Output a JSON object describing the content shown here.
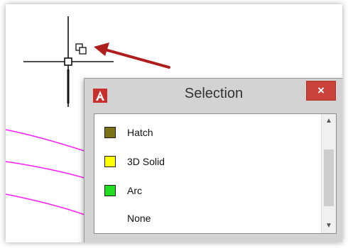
{
  "dialog": {
    "title": "Selection",
    "close_label": "×",
    "items": [
      {
        "label": "Hatch",
        "color": "#7a7118"
      },
      {
        "label": "3D Solid",
        "color": "#ffff00"
      },
      {
        "label": "Arc",
        "color": "#22dd22"
      },
      {
        "label": "None",
        "color": ""
      }
    ],
    "app_icon": "autocad-icon"
  },
  "scroll": {
    "up_label": "▲",
    "down_label": "▼"
  },
  "canvas": {
    "curve_color": "#ff1aff",
    "arrow_color": "#b01d1d"
  }
}
